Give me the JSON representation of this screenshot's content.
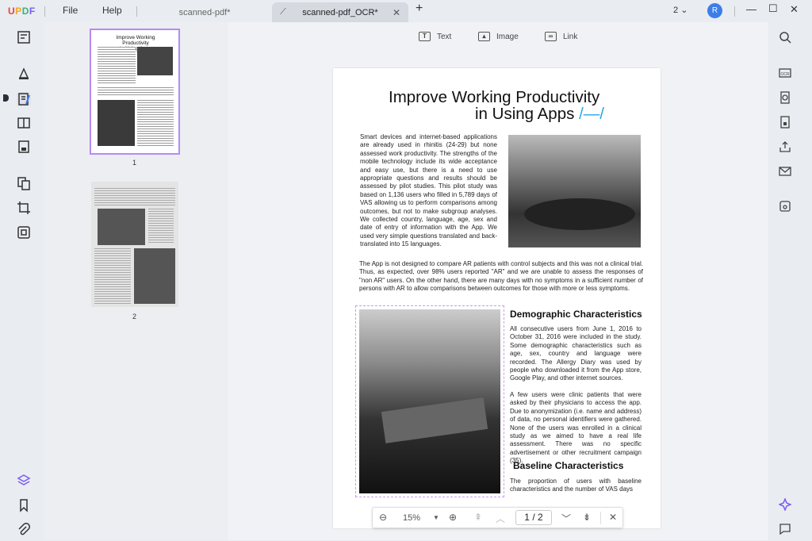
{
  "app": {
    "logo": "UPDF",
    "menu_file": "File",
    "menu_help": "Help"
  },
  "tabs": [
    {
      "label": "scanned-pdf*"
    },
    {
      "label": "scanned-pdf_OCR*"
    }
  ],
  "window": {
    "page_count_badge": "2",
    "avatar_initial": "R"
  },
  "toolbar": {
    "text_label": "Text",
    "image_label": "Image",
    "link_label": "Link"
  },
  "thumbnails": [
    {
      "number": "1"
    },
    {
      "number": "2"
    }
  ],
  "document": {
    "title_line1": "Improve Working Productivity",
    "title_line2": "in Using Apps",
    "title_mark": "/—/",
    "para1": "Smart devices and internet-based applications are already used in rhinitis (24-29) but none assessed work productivity. The strengths of the mobile technology include its wide acceptance and easy use, but there is a need to use appropriate questions and results should be assessed by pilot studies. This pilot study was based on 1,136 users who filled in 5,789 days of VAS allowing us to perform comparisons among outcomes, but not to make subgroup analyses. We collected country, language, age, sex and date of entry of information with the App. We used very simple questions translated and back-translated into 15 languages.",
    "para2": "The App is not designed to compare AR patients with control subjects and this was not a clinical trial. Thus, as expected, over 98% users reported \"AR\" and we are unable to assess the responses of \"non AR\" users. On the other hand, there are many days with no symptoms in a sufficient number of persons with AR to allow comparisons between outcomes for those with more or less symptoms.",
    "heading_demo": "Demographic Characteristics",
    "para3": "All consecutive users from June 1, 2016 to October 31, 2016 were included in the study. Some demographic characteristics such as age, sex, country and language were recorded. The Allergy Diary was used by people who downloaded it from the App store, Google Play, and other internet sources.",
    "para4": "A few users were clinic patients that were asked by their physicians to access the app. Due to anonymization (i.e. name and address) of data, no personal identifiers were gathered. None of the users was enrolled in a clinical study as we aimed to have a real life assessment. There was no specific advertisement or other recruitment campaign (35).",
    "heading_base": "Baseline Characteristics",
    "para5": "The proportion of users with baseline characteristics and the number of VAS days"
  },
  "zoom": {
    "level": "15%",
    "current_page": "1",
    "total_pages": "2",
    "separator": "/"
  },
  "colors": {
    "accent": "#3d7de8",
    "selection": "#b68af5",
    "title_mark": "#2aa5e8"
  }
}
